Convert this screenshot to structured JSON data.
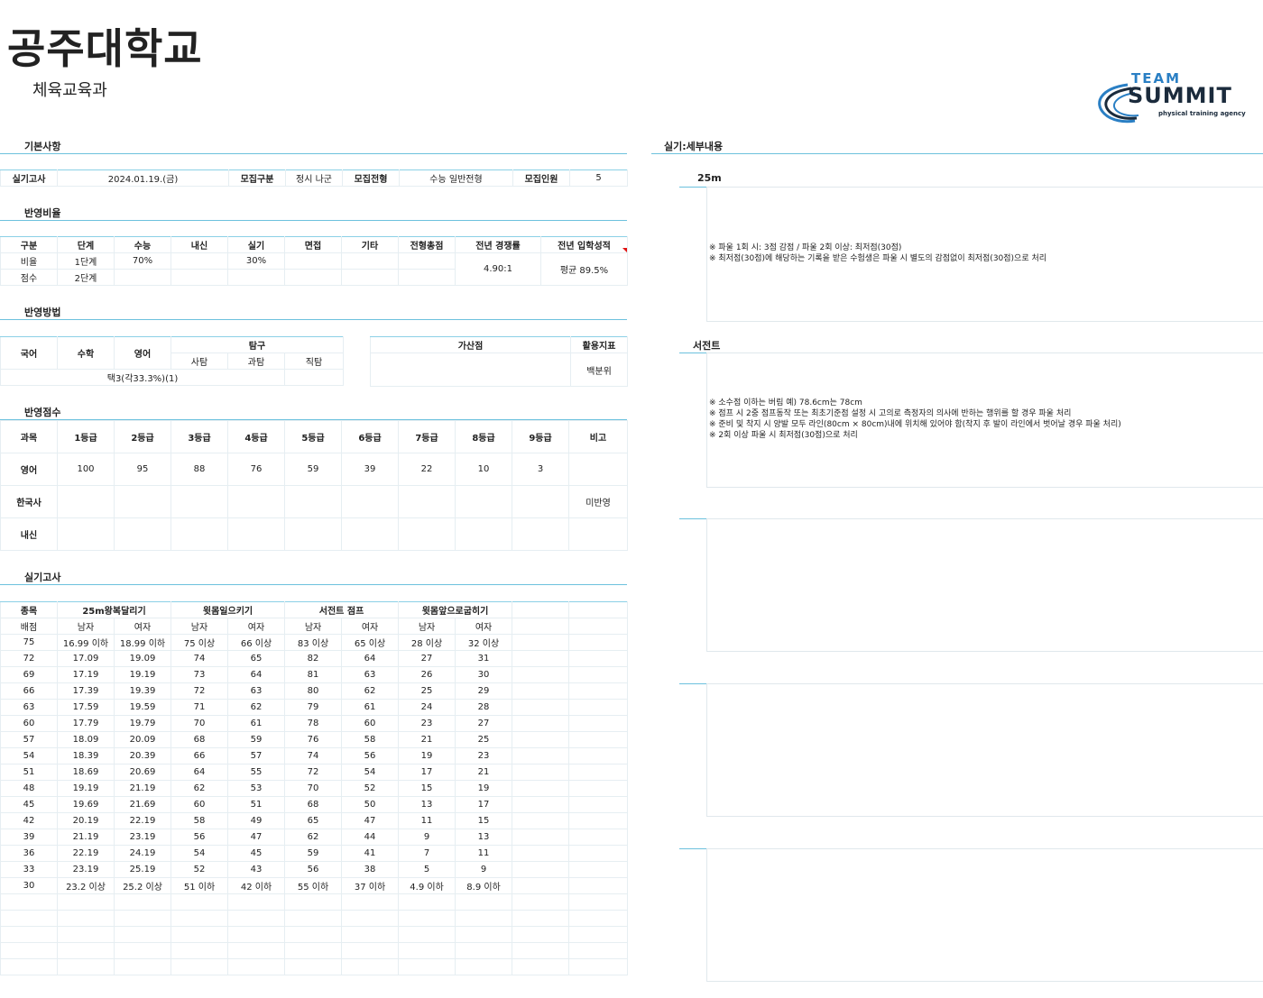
{
  "header": {
    "title": "공주대학교",
    "subtitle": "체육교육과"
  },
  "logo": {
    "line1": "TEAM",
    "line2": "SUMMIT",
    "tagline": "physical training agency"
  },
  "sections": {
    "basic": "기본사항",
    "ratio": "반영비율",
    "method": "반영방법",
    "score": "반영점수",
    "practical": "실기고사",
    "detail": "실기:세부내용"
  },
  "basic": {
    "c0": "실기고사",
    "c1": "2024.01.19.(금)",
    "c2": "모집구분",
    "c3": "정시 나군",
    "c4": "모집전형",
    "c5": "수능 일반전형",
    "c6": "모집인원",
    "c7": "5"
  },
  "ratio": {
    "headers": [
      "구분",
      "단계",
      "수능",
      "내신",
      "실기",
      "면접",
      "기타",
      "전형총점",
      "전년 경쟁률",
      "전년 입학성적"
    ],
    "row1": [
      "비율",
      "1단계",
      "70%",
      "",
      "30%",
      "",
      "",
      ""
    ],
    "row2": [
      "점수",
      "2단계",
      "",
      "",
      "",
      "",
      "",
      ""
    ],
    "competition": "4.90:1",
    "admission": "평균 89.5%"
  },
  "method": {
    "korean": "국어",
    "math": "수학",
    "english": "영어",
    "inquiry": "탐구",
    "social": "사탐",
    "science": "과탐",
    "vocational": "직탐",
    "choice": "택3(각33.3%)(1)",
    "bonus": "가산점",
    "indicator": "활용지표",
    "indicator_value": "백분위"
  },
  "score": {
    "headers": [
      "과목",
      "1등급",
      "2등급",
      "3등급",
      "4등급",
      "5등급",
      "6등급",
      "7등급",
      "8등급",
      "9등급",
      "비고"
    ],
    "rows": [
      [
        "영어",
        "100",
        "95",
        "88",
        "76",
        "59",
        "39",
        "22",
        "10",
        "3",
        ""
      ],
      [
        "한국사",
        "",
        "",
        "",
        "",
        "",
        "",
        "",
        "",
        "",
        "미반영"
      ],
      [
        "내신",
        "",
        "",
        "",
        "",
        "",
        "",
        "",
        "",
        "",
        ""
      ]
    ]
  },
  "practical": {
    "col0": "종목",
    "events": [
      "25m왕복달리기",
      "윗몸일으키기",
      "서전트 점프",
      "윗몸앞으로굽히기"
    ],
    "sub": [
      "배점",
      "남자",
      "여자",
      "남자",
      "여자",
      "남자",
      "여자",
      "남자",
      "여자"
    ],
    "rows": [
      [
        "75",
        "16.99 이하",
        "18.99 이하",
        "75 이상",
        "66 이상",
        "83 이상",
        "65 이상",
        "28 이상",
        "32 이상"
      ],
      [
        "72",
        "17.09",
        "19.09",
        "74",
        "65",
        "82",
        "64",
        "27",
        "31"
      ],
      [
        "69",
        "17.19",
        "19.19",
        "73",
        "64",
        "81",
        "63",
        "26",
        "30"
      ],
      [
        "66",
        "17.39",
        "19.39",
        "72",
        "63",
        "80",
        "62",
        "25",
        "29"
      ],
      [
        "63",
        "17.59",
        "19.59",
        "71",
        "62",
        "79",
        "61",
        "24",
        "28"
      ],
      [
        "60",
        "17.79",
        "19.79",
        "70",
        "61",
        "78",
        "60",
        "23",
        "27"
      ],
      [
        "57",
        "18.09",
        "20.09",
        "68",
        "59",
        "76",
        "58",
        "21",
        "25"
      ],
      [
        "54",
        "18.39",
        "20.39",
        "66",
        "57",
        "74",
        "56",
        "19",
        "23"
      ],
      [
        "51",
        "18.69",
        "20.69",
        "64",
        "55",
        "72",
        "54",
        "17",
        "21"
      ],
      [
        "48",
        "19.19",
        "21.19",
        "62",
        "53",
        "70",
        "52",
        "15",
        "19"
      ],
      [
        "45",
        "19.69",
        "21.69",
        "60",
        "51",
        "68",
        "50",
        "13",
        "17"
      ],
      [
        "42",
        "20.19",
        "22.19",
        "58",
        "49",
        "65",
        "47",
        "11",
        "15"
      ],
      [
        "39",
        "21.19",
        "23.19",
        "56",
        "47",
        "62",
        "44",
        "9",
        "13"
      ],
      [
        "36",
        "22.19",
        "24.19",
        "54",
        "45",
        "59",
        "41",
        "7",
        "11"
      ],
      [
        "33",
        "23.19",
        "25.19",
        "52",
        "43",
        "56",
        "38",
        "5",
        "9"
      ],
      [
        "30",
        "23.2 이상",
        "25.2 이상",
        "51 이하",
        "42 이하",
        "55 이하",
        "37 이하",
        "4.9 이하",
        "8.9 이하"
      ]
    ]
  },
  "detail": {
    "t1": "25m",
    "n1": [
      "※ 파울 1회 시: 3점 감점 / 파울 2회 이상: 최저점(30점)",
      "※ 최저점(30점)에 해당하는 기록을 받은 수험생은 파울 시 별도의 감점없이 최저점(30점)으로 처리"
    ],
    "t2": "서전트",
    "n2": [
      "※ 소수점 이하는 버림   예) 78.6cm는 78cm",
      "※ 점프 시 2중 점프동작 또는 최초기준점 설정 시 고의로 측정자의 의사에 반하는 행위를 할 경우 파울 처리",
      "※ 준비 및 착지 시 양발 모두 라인(80cm × 80cm)내에 위치해 있어야 함(착지 후 발이 라인에서 벗어날 경우 파울 처리)",
      "※ 2회 이상 파울 시 최저점(30점)으로 처리"
    ]
  },
  "colors": {
    "accent": "#6cc1dd",
    "logo_blue": "#2a7fc4",
    "logo_dark": "#1b2b3c",
    "marker": "#e01010"
  }
}
